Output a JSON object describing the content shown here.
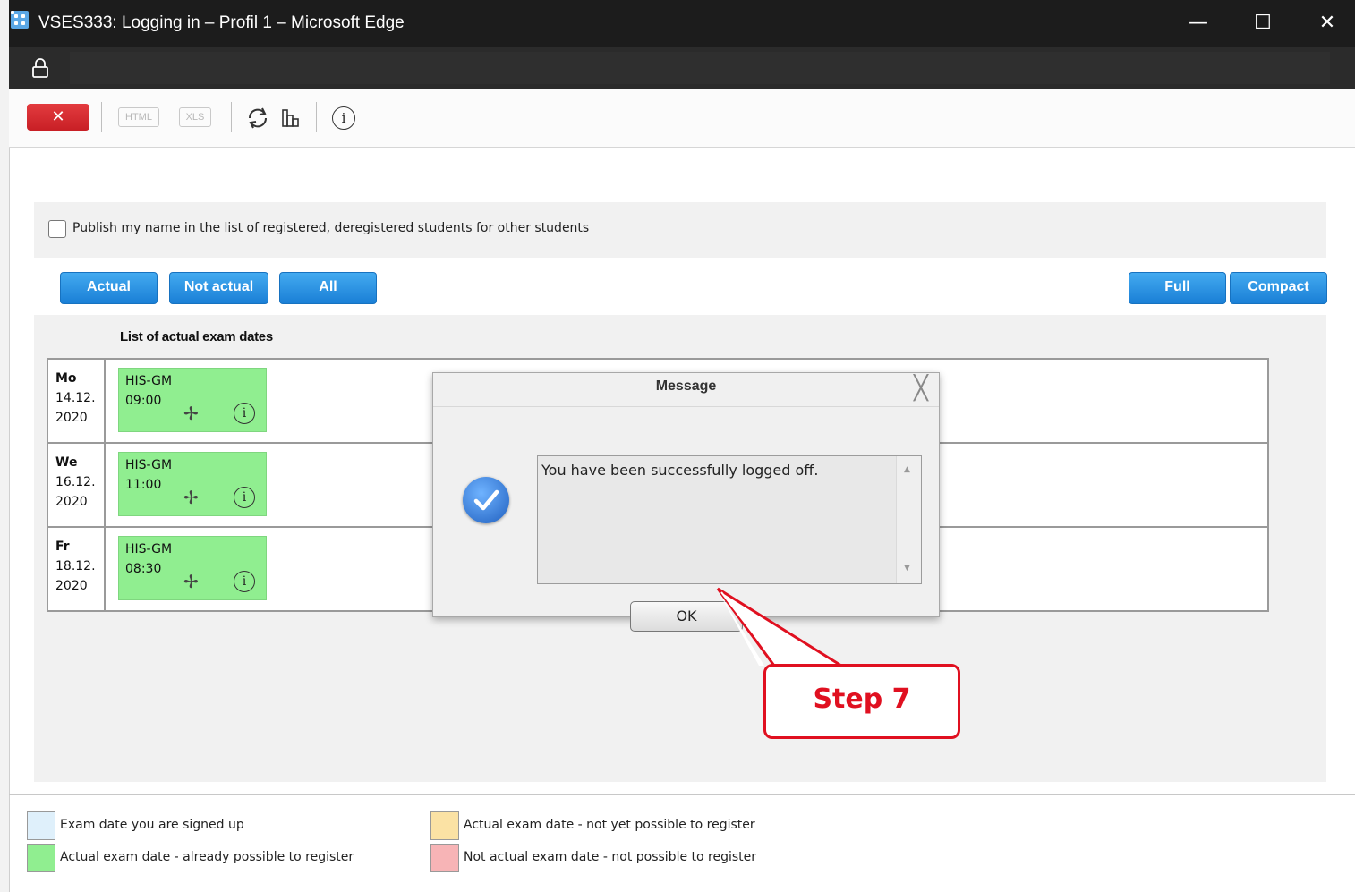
{
  "window": {
    "title": "VSES333: Logging in – Profil 1 – Microsoft Edge",
    "minimize_glyph": "—",
    "maximize_glyph": "☐",
    "close_glyph": "✕"
  },
  "toolbar": {
    "close_glyph": "✕",
    "html_label": "HTML",
    "xls_label": "XLS",
    "icons": [
      "refresh-icon",
      "table-icon",
      "info-icon"
    ]
  },
  "publish": {
    "label": "Publish my name in the list of registered, deregistered students for other students",
    "checked": false
  },
  "filters": {
    "actual": "Actual",
    "not_actual": "Not actual",
    "all": "All",
    "full": "Full",
    "compact": "Compact"
  },
  "list": {
    "title": "List of actual exam dates",
    "rows": [
      {
        "day": "Mo",
        "date": "14.12.",
        "year": "2020",
        "exam": "HIS-GM",
        "time": "09:00"
      },
      {
        "day": "We",
        "date": "16.12.",
        "year": "2020",
        "exam": "HIS-GM",
        "time": "11:00"
      },
      {
        "day": "Fr",
        "date": "18.12.",
        "year": "2020",
        "exam": "HIS-GM",
        "time": "08:30"
      }
    ]
  },
  "dialog": {
    "title": "Message",
    "message": "You have been successfully logged off.",
    "ok_label": "OK"
  },
  "callout": {
    "label": "Step 7",
    "color": "#e01020"
  },
  "legend": [
    {
      "label": "Exam date you are signed up",
      "color": "#dff0fb"
    },
    {
      "label": "Actual exam date - already possible to register",
      "color": "#90ee90"
    },
    {
      "label": "Actual exam date - not yet possible to register",
      "color": "#fbe2a4"
    },
    {
      "label": "Not actual exam date - not possible to register",
      "color": "#f7b4b6"
    }
  ]
}
